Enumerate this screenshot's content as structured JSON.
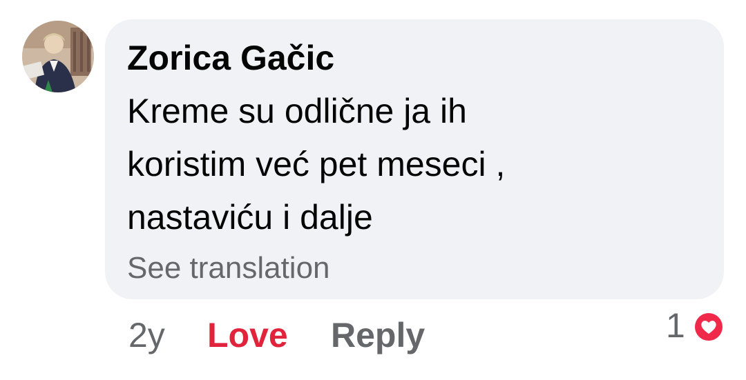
{
  "comment": {
    "author": "Zorica Gačic",
    "text_lines": [
      "Kreme su odlične ja ih",
      "koristim već pet meseci ,",
      "nastaviću i dalje"
    ],
    "see_translation": "See translation"
  },
  "actions": {
    "time": "2y",
    "love_label": "Love",
    "reply_label": "Reply"
  },
  "reactions": {
    "count": "1",
    "icon": "love-reaction-icon",
    "color": "#f0284a"
  },
  "colors": {
    "bubble": "#f0f2f5",
    "love_active": "#e0243c",
    "secondary_text": "#65676b"
  }
}
